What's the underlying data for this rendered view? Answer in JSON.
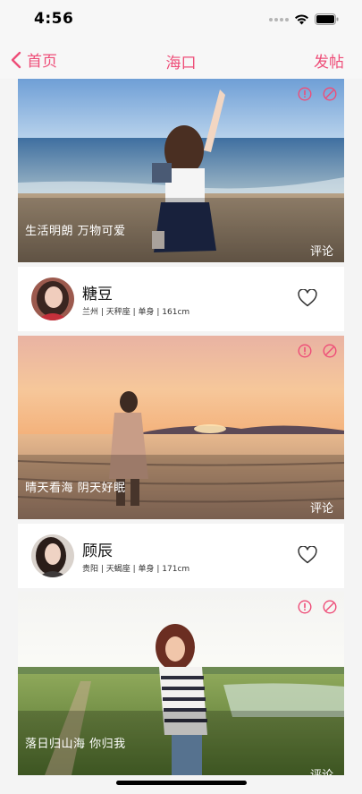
{
  "status_bar": {
    "time": "4:56"
  },
  "nav": {
    "back_label": "首页",
    "title": "海口",
    "post_label": "发帖"
  },
  "colors": {
    "accent": "#ee4d78"
  },
  "posts": [
    {
      "caption": "生活明朗 万物可爱",
      "comment_label": "评论",
      "user": {
        "name": "糖豆",
        "meta": "兰州 | 天秤座 | 单身 | 161cm"
      }
    },
    {
      "caption": "晴天看海 阴天好眠",
      "comment_label": "评论",
      "user": {
        "name": "顾辰",
        "meta": "贵阳 | 天蝎座 | 单身 | 171cm"
      }
    },
    {
      "caption": "落日归山海 你归我",
      "comment_label": "评论"
    }
  ]
}
